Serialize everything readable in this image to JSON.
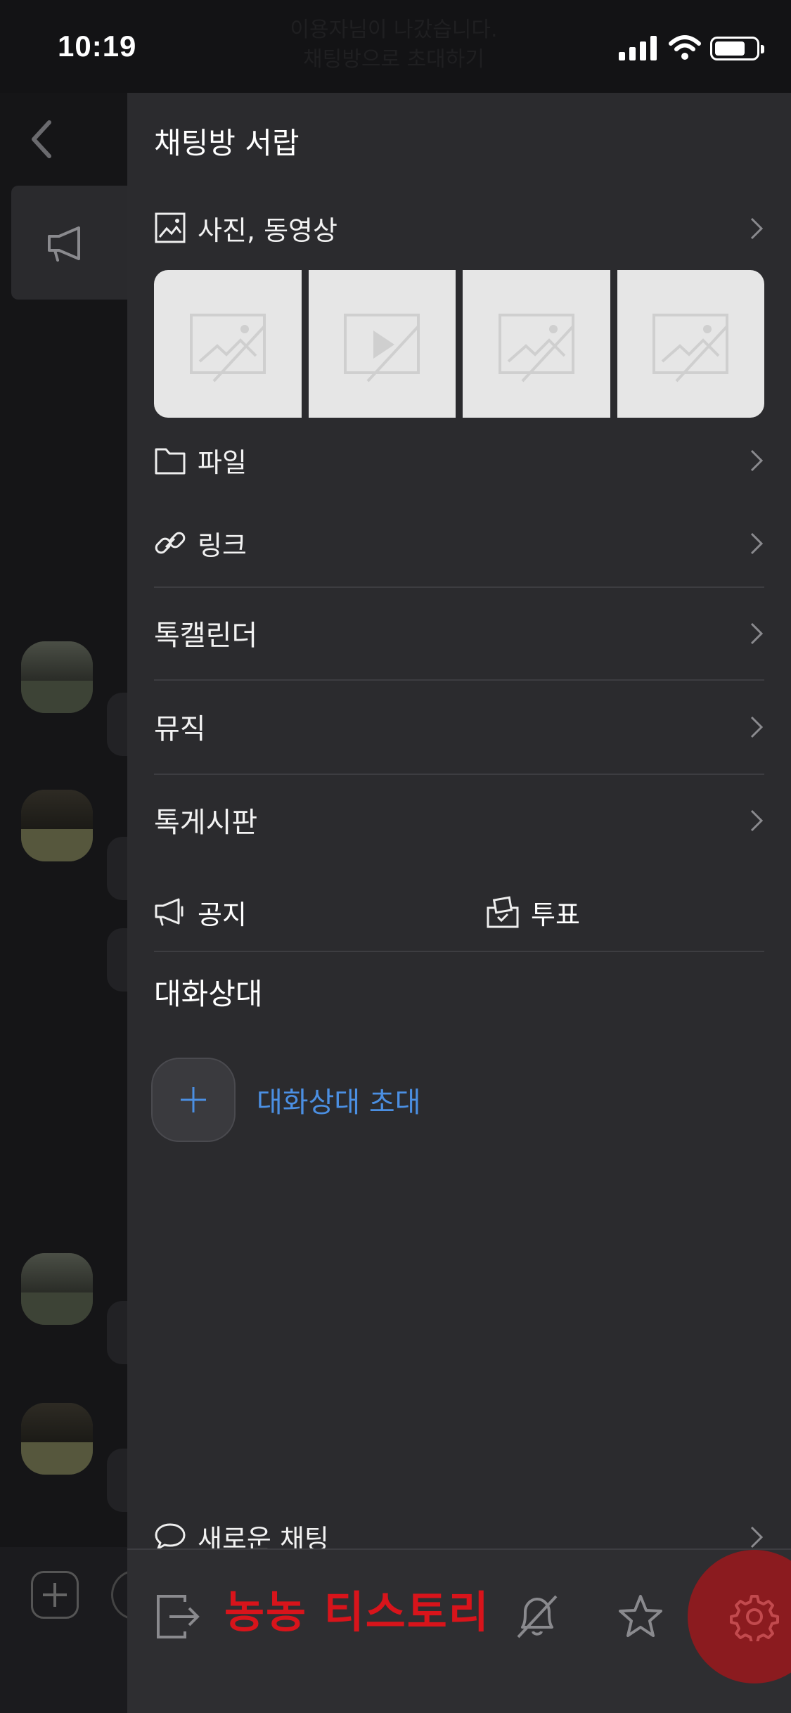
{
  "status_bar": {
    "time": "10:19",
    "background_text_line1": "이용자님이 나갔습니다.",
    "background_text_line2": "채팅방으로 초대하기"
  },
  "drawer": {
    "title": "채팅방 서랍",
    "media": {
      "label": "사진, 동영상",
      "thumbnails": [
        {
          "kind": "image-placeholder"
        },
        {
          "kind": "video-placeholder"
        },
        {
          "kind": "image-placeholder"
        },
        {
          "kind": "image-placeholder"
        }
      ]
    },
    "file_label": "파일",
    "link_label": "링크",
    "talk_calendar_label": "톡캘린더",
    "music_label": "뮤직",
    "talk_board_label": "톡게시판",
    "notice_label": "공지",
    "vote_label": "투표",
    "members_title": "대화상대",
    "invite_label": "대화상대 초대",
    "new_chat_label": "새로운 채팅",
    "watermark": "농농 티스토리"
  },
  "colors": {
    "drawer_bg": "#2b2b2e",
    "accent_blue": "#4b8fe2",
    "watermark_red": "#d8141b",
    "settings_circle": "#8b1b1f"
  },
  "icons": {
    "media": "image-icon",
    "file": "folder-icon",
    "link": "link-icon",
    "notice": "megaphone-icon",
    "vote": "ballot-box-icon",
    "invite": "plus-icon",
    "new_chat": "speech-bubble-icon",
    "leave": "exit-icon",
    "mute": "bell-off-icon",
    "favorite": "star-icon",
    "settings": "gear-icon"
  }
}
